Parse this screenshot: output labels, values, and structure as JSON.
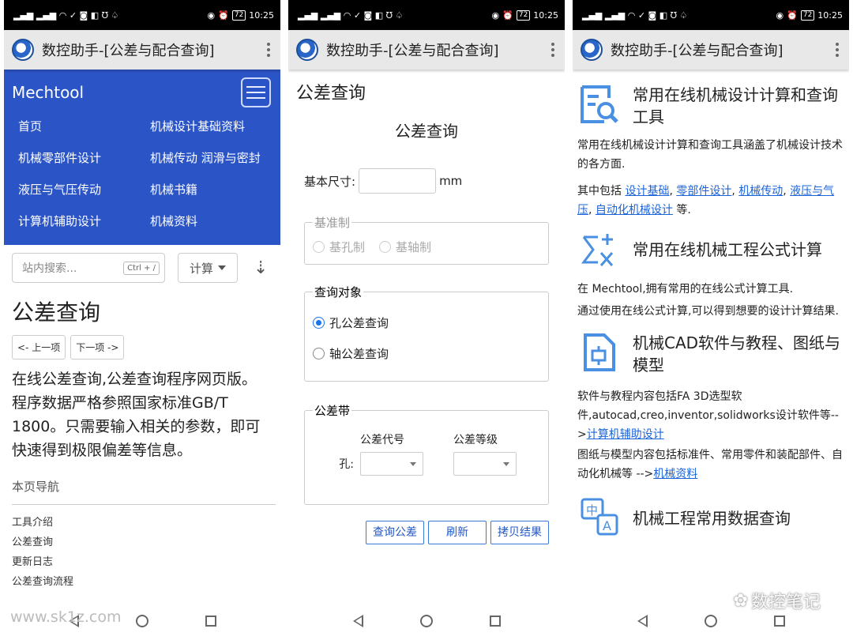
{
  "status": {
    "time": "10:25",
    "battery": "72"
  },
  "app": {
    "title": "数控助手-[公差与配合查询]"
  },
  "phone1": {
    "brand": "Mechtool",
    "menu": [
      "首页",
      "机械设计基础资料",
      "机械零部件设计",
      "机械传动 润滑与密封",
      "液压与气压传动",
      "机械书籍",
      "计算机辅助设计",
      "机械资料"
    ],
    "search_placeholder": "站内搜索...",
    "search_shortcut": "Ctrl + /",
    "calc_label": "计算",
    "heading": "公差查询",
    "prev": "<- 上一项",
    "next": "下一项 ->",
    "intro": "在线公差查询,公差查询程序网页版。程序数据严格参照国家标准GB/T 1800。只需要输入相关的参数，即可快速得到极限偏差等信息。",
    "toc_title": "本页导航",
    "toc": [
      "工具介绍",
      "公差查询",
      "更新日志",
      "公差查询流程"
    ],
    "watermark": "www.sk1z.com"
  },
  "phone2": {
    "page_heading": "公差查询",
    "form_title": "公差查询",
    "size_label": "基本尺寸:",
    "size_value": "",
    "size_unit": "mm",
    "base_legend": "基准制",
    "base_options": [
      "基孔制",
      "基轴制"
    ],
    "target_legend": "查询对象",
    "target_options": [
      "孔公差查询",
      "轴公差查询"
    ],
    "target_selected": "孔公差查询",
    "band_legend": "公差带",
    "band_col1": "公差代号",
    "band_col2": "公差等级",
    "band_row": "孔:",
    "buttons": [
      "查询公差",
      "刷新",
      "拷贝结果"
    ]
  },
  "phone3": {
    "s1_title": "常用在线机械设计计算和查询工具",
    "s1_p1": "常用在线机械设计计算和查询工具涵盖了机械设计技术的各方面.",
    "s1_p2_pre": "其中包括 ",
    "s1_links": [
      "设计基础",
      "零部件设计",
      "机械传动",
      "液压与气压",
      "自动化机械设计"
    ],
    "s1_p2_post": " 等.",
    "s2_title": "常用在线机械工程公式计算",
    "s2_p1": "在 Mechtool,拥有常用的在线公式计算工具.",
    "s2_p2": "通过使用在线公式计算,可以得到想要的设计计算结果.",
    "s3_title": "机械CAD软件与教程、图纸与模型",
    "s3_p1": "软件与教程内容包括FA 3D选型软件,autocad,creo,inventor,solidworks设计软件等-->",
    "s3_link1": "计算机辅助设计",
    "s3_p2": "图纸与模型内容包括标准件、常用零件和装配部件、自动化机械等 -->",
    "s3_link2": "机械资料",
    "s4_title": "机械工程常用数据查询",
    "watermark": "数控笔记"
  },
  "colors": {
    "menu_bg": "#2b55c6",
    "link": "#1a63d8",
    "icon": "#4a90e2"
  }
}
